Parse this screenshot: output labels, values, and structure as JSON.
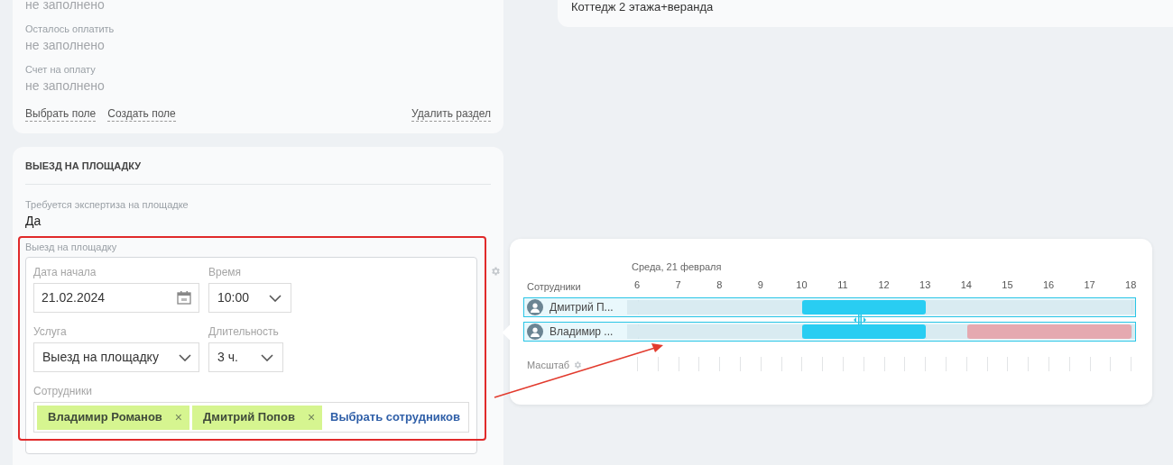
{
  "payment_card": {
    "fields": [
      {
        "value": "не заполнено"
      },
      {
        "label": "Осталось оплатить",
        "value": "не заполнено"
      },
      {
        "label": "Счет на оплату",
        "value": "не заполнено"
      }
    ],
    "links": [
      "Выбрать поле",
      "Создать поле"
    ],
    "delete_link": "Удалить раздел"
  },
  "site_visit_card": {
    "title": "ВЫЕЗД НА ПЛОЩАДКУ",
    "field": {
      "label": "Требуется экспертиза на площадке",
      "value": "Да"
    },
    "group_label": "Выезд на площадку",
    "start_date": {
      "label": "Дата начала",
      "value": "21.02.2024"
    },
    "time": {
      "label": "Время",
      "value": "10:00"
    },
    "service": {
      "label": "Услуга",
      "value": "Выезд на площадку"
    },
    "duration": {
      "label": "Длительность",
      "value": "3 ч."
    },
    "staff": {
      "label": "Сотрудники",
      "tags": [
        "Владимир Романов",
        "Дмитрий Попов"
      ],
      "remove_mark": "×",
      "action": "Выбрать сотрудников"
    }
  },
  "object_card": {
    "text": "Коттедж 2 этажа+веранда"
  },
  "schedule": {
    "date": "Среда, 21 февраля",
    "column_header": "Сотрудники",
    "hours": [
      "6",
      "7",
      "8",
      "9",
      "10",
      "11",
      "12",
      "13",
      "14",
      "15",
      "16",
      "17",
      "18"
    ],
    "rows": [
      {
        "name": "Дмитрий П...",
        "half_hour_slots": [
          {
            "color": "#d9ebf1"
          },
          {
            "color": "#d9ebf1"
          },
          {
            "color": "#d9ebf1"
          },
          {
            "color": "#d9ebf1"
          },
          {
            "color": "#d9ebf1"
          },
          {
            "color": "#d9ebf1"
          },
          {
            "color": "#d9ebf1"
          },
          {
            "color": "#d9ebf1"
          },
          {
            "color": "#29cdf2"
          },
          {
            "color": "#29cdf2"
          },
          {
            "color": "#29cdf2"
          },
          {
            "color": "#29cdf2"
          },
          {
            "color": "#29cdf2"
          },
          {
            "color": "#29cdf2"
          },
          {
            "color": "#d9ebf1"
          },
          {
            "color": "#d9ebf1"
          },
          {
            "color": "#d9ebf1"
          },
          {
            "color": "#d9ebf1"
          },
          {
            "color": "#d9ebf1"
          },
          {
            "color": "#d9ebf1"
          },
          {
            "color": "#d9ebf1"
          },
          {
            "color": "#d9ebf1"
          },
          {
            "color": "#d9ebf1"
          },
          {
            "color": "#d9ebf1"
          }
        ]
      },
      {
        "name": "Владимир ...",
        "half_hour_slots": [
          {
            "color": "#d9ebf1"
          },
          {
            "color": "#d9ebf1"
          },
          {
            "color": "#d9ebf1"
          },
          {
            "color": "#d9ebf1"
          },
          {
            "color": "#d9ebf1"
          },
          {
            "color": "#d9ebf1"
          },
          {
            "color": "#d9ebf1"
          },
          {
            "color": "#d9ebf1"
          },
          {
            "color": "#29cdf2"
          },
          {
            "color": "#29cdf2"
          },
          {
            "color": "#29cdf2"
          },
          {
            "color": "#29cdf2"
          },
          {
            "color": "#29cdf2"
          },
          {
            "color": "#29cdf2"
          },
          {
            "color": "#d9ebf1"
          },
          {
            "color": "#d9ebf1"
          },
          {
            "color": "#e5a9b0"
          },
          {
            "color": "#e5a9b0"
          },
          {
            "color": "#e5a9b0"
          },
          {
            "color": "#e5a9b0"
          },
          {
            "color": "#e5a9b0"
          },
          {
            "color": "#e5a9b0"
          },
          {
            "color": "#e5a9b0"
          },
          {
            "color": "#e5a9b0"
          }
        ]
      }
    ],
    "scale_label": "Масштаб"
  }
}
